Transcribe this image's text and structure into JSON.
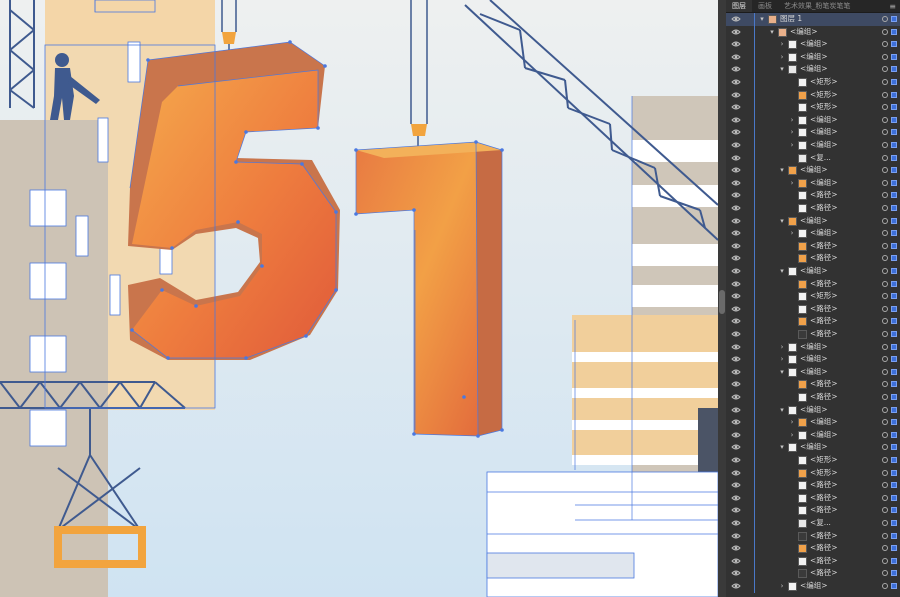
{
  "app": {
    "panel_tabs": [
      "图层",
      "画板",
      "艺术效果_粉笔炭笔笔"
    ]
  },
  "artwork": {
    "number_five": "5",
    "number_one": "1",
    "colors": {
      "background_top": "#eef0f0",
      "background_bottom": "#cfe3f2",
      "orange_light": "#f2a046",
      "orange_dark": "#e0573a",
      "orange_side": "#c8704a",
      "crane_blue": "#3f5a8f",
      "selection_blue": "#4a78e0",
      "building_tan": "#ccc3b6",
      "building_peach": "#f3d5a8",
      "window_white": "#ffffff"
    }
  },
  "layers": [
    {
      "label": "图层 1",
      "depth": 0,
      "expand": "▾",
      "thumb": "art"
    },
    {
      "label": "<编组>",
      "depth": 1,
      "expand": "▾",
      "thumb": "art"
    },
    {
      "label": "<编组>",
      "depth": 2,
      "expand": "›",
      "thumb": "white"
    },
    {
      "label": "<编组>",
      "depth": 2,
      "expand": "›",
      "thumb": "white"
    },
    {
      "label": "<编组>",
      "depth": 2,
      "expand": "▾",
      "thumb": "lines"
    },
    {
      "label": "<矩形>",
      "depth": 3,
      "expand": "",
      "thumb": "white"
    },
    {
      "label": "<矩形>",
      "depth": 3,
      "expand": "",
      "thumb": "orange"
    },
    {
      "label": "<矩形>",
      "depth": 3,
      "expand": "",
      "thumb": "white"
    },
    {
      "label": "<编组>",
      "depth": 3,
      "expand": "›",
      "thumb": "white"
    },
    {
      "label": "<编组>",
      "depth": 3,
      "expand": "›",
      "thumb": "white"
    },
    {
      "label": "<编组>",
      "depth": 3,
      "expand": "›",
      "thumb": "white"
    },
    {
      "label": "<复...",
      "depth": 3,
      "expand": "",
      "thumb": "lines"
    },
    {
      "label": "<编组>",
      "depth": 2,
      "expand": "▾",
      "thumb": "orange"
    },
    {
      "label": "<编组>",
      "depth": 3,
      "expand": "›",
      "thumb": "orange"
    },
    {
      "label": "<路径>",
      "depth": 3,
      "expand": "",
      "thumb": "white"
    },
    {
      "label": "<路径>",
      "depth": 3,
      "expand": "",
      "thumb": "white"
    },
    {
      "label": "<编组>",
      "depth": 2,
      "expand": "▾",
      "thumb": "orange"
    },
    {
      "label": "<编组>",
      "depth": 3,
      "expand": "›",
      "thumb": "white"
    },
    {
      "label": "<路径>",
      "depth": 3,
      "expand": "",
      "thumb": "orange"
    },
    {
      "label": "<路径>",
      "depth": 3,
      "expand": "",
      "thumb": "orange"
    },
    {
      "label": "<编组>",
      "depth": 2,
      "expand": "▾",
      "thumb": "white"
    },
    {
      "label": "<路径>",
      "depth": 3,
      "expand": "",
      "thumb": "orange"
    },
    {
      "label": "<矩形>",
      "depth": 3,
      "expand": "",
      "thumb": "white"
    },
    {
      "label": "<路径>",
      "depth": 3,
      "expand": "",
      "thumb": "white"
    },
    {
      "label": "<路径>",
      "depth": 3,
      "expand": "",
      "thumb": "orange"
    },
    {
      "label": "<路径>",
      "depth": 3,
      "expand": "",
      "thumb": "dark"
    },
    {
      "label": "<编组>",
      "depth": 2,
      "expand": "›",
      "thumb": "white"
    },
    {
      "label": "<编组>",
      "depth": 2,
      "expand": "›",
      "thumb": "white"
    },
    {
      "label": "<编组>",
      "depth": 2,
      "expand": "▾",
      "thumb": "white"
    },
    {
      "label": "<路径>",
      "depth": 3,
      "expand": "",
      "thumb": "orange"
    },
    {
      "label": "<路径>",
      "depth": 3,
      "expand": "",
      "thumb": "white"
    },
    {
      "label": "<编组>",
      "depth": 2,
      "expand": "▾",
      "thumb": "white"
    },
    {
      "label": "<编组>",
      "depth": 3,
      "expand": "›",
      "thumb": "orange"
    },
    {
      "label": "<编组>",
      "depth": 3,
      "expand": "›",
      "thumb": "white"
    },
    {
      "label": "<编组>",
      "depth": 2,
      "expand": "▾",
      "thumb": "white"
    },
    {
      "label": "<矩形>",
      "depth": 3,
      "expand": "",
      "thumb": "white"
    },
    {
      "label": "<矩形>",
      "depth": 3,
      "expand": "",
      "thumb": "orange"
    },
    {
      "label": "<路径>",
      "depth": 3,
      "expand": "",
      "thumb": "white"
    },
    {
      "label": "<路径>",
      "depth": 3,
      "expand": "",
      "thumb": "white"
    },
    {
      "label": "<路径>",
      "depth": 3,
      "expand": "",
      "thumb": "white"
    },
    {
      "label": "<复...",
      "depth": 3,
      "expand": "",
      "thumb": "lines"
    },
    {
      "label": "<路径>",
      "depth": 3,
      "expand": "",
      "thumb": "dark"
    },
    {
      "label": "<路径>",
      "depth": 3,
      "expand": "",
      "thumb": "orange"
    },
    {
      "label": "<路径>",
      "depth": 3,
      "expand": "",
      "thumb": "white"
    },
    {
      "label": "<路径>",
      "depth": 3,
      "expand": "",
      "thumb": "dark"
    },
    {
      "label": "<编组>",
      "depth": 2,
      "expand": "›",
      "thumb": "white"
    }
  ]
}
